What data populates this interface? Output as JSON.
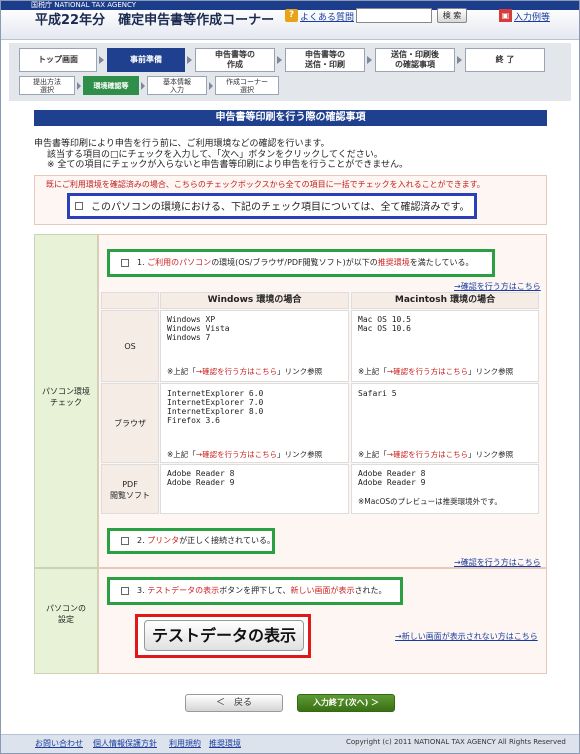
{
  "header": {
    "agency": "国税庁  NATIONAL TAX AGENCY",
    "title": "平成22年分　確定申告書等作成コーナー",
    "faq_icon": "?",
    "faq_label": "よくある質問",
    "search_label": "検 索",
    "input_example_label": "入力例等"
  },
  "steps": {
    "top": "トップ画面",
    "prep": "事前準備",
    "create": "申告書等の\n作成",
    "send": "申告書等の\n送信・印刷",
    "after": "送信・印刷後\nの確認事項",
    "end": "終 了",
    "sub1": "提出方法\n選択",
    "sub2": "環境確認等",
    "sub3": "基本情報\n入力",
    "sub4": "作成コーナー\n選択"
  },
  "banner": "申告書等印刷を行う際の確認事項",
  "intro": {
    "line1": "申告書等印刷により申告を行う前に、ご利用環境などの確認を行います。",
    "line2": "該当する項目の□にチェックを入力して、「次へ」ボタンをクリックしてください。",
    "line3": "※ 全ての項目にチェックが入らないと申告書等印刷により申告を行うことができません。"
  },
  "all_check": {
    "note": "既にご利用環境を確認済みの場合、こちらのチェックボックスから全ての項目に一括でチェックを入れることができます。",
    "label": "このパソコンの環境における、下記のチェック項目については、全て確認済みです。"
  },
  "section1": {
    "label": "パソコン環境\nチェック",
    "check1_prefix": "1.",
    "check1_red1": "ご利用のパソコン",
    "check1_mid": "の環境(OS/ブラウザ/PDF閲覧ソフト)が以下の",
    "check1_red2": "推奨環境",
    "check1_end": "を満たしている。",
    "link1": "→確認を行う方はこちら",
    "check2_prefix": "2.",
    "check2_red": "プリンタ",
    "check2_end": "が正しく接続されている。",
    "link2": "→確認を行う方はこちら"
  },
  "env_table": {
    "col_windows": "Windows 環境の場合",
    "col_mac": "Macintosh 環境の場合",
    "row_os": "OS",
    "row_browser": "ブラウザ",
    "row_pdf": "PDF\n閲覧ソフト",
    "os_win": "Windows XP\nWindows Vista\nWindows 7",
    "os_mac": "Mac OS 10.5\nMac OS 10.6",
    "browser_win": "InternetExplorer 6.0\nInternetExplorer 7.0\nInternetExplorer 8.0\nFirefox 3.6",
    "browser_mac": "Safari 5",
    "pdf_win": "Adobe Reader 8\nAdobe Reader 9",
    "pdf_mac": "Adobe Reader 8\nAdobe Reader 9",
    "ref_pre": "※上記「",
    "ref_red": "→確認を行う方はこちら",
    "ref_post": "」リンク参照",
    "mac_note": "※MacOSのプレビューは推奨環境外です。"
  },
  "section2": {
    "label": "パソコンの\n設定",
    "check3_prefix": "3.",
    "check3_red1": "テストデータの表示",
    "check3_mid": "ボタンを押下して、",
    "check3_red2": "新しい画面が表示",
    "check3_end": "された。",
    "test_button": "テストデータの表示",
    "link3": "→新しい画面が表示されない方はこちら"
  },
  "buttons": {
    "back": "＜　戻る",
    "next": "入力終了(次へ) ＞"
  },
  "footer": {
    "contact": "お問い合わせ",
    "privacy": "個人情報保護方針",
    "terms": "利用規約",
    "env": "推奨環境",
    "copyright": "Copyright (c) 2011 NATIONAL TAX AGENCY All Rights Reserved"
  },
  "colors": {
    "navy": "#1f3f8f",
    "green_step": "#2f8f4a",
    "frame_green": "#2aa043",
    "frame_blue": "#2b3fb8",
    "frame_red": "#e01818",
    "link": "#1a3ca0"
  }
}
